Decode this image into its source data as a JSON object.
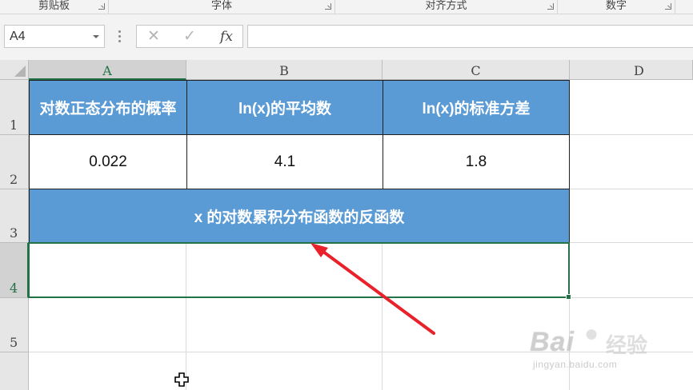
{
  "ribbon": {
    "groups": [
      {
        "label": "剪贴板"
      },
      {
        "label": "字体"
      },
      {
        "label": "对齐方式"
      },
      {
        "label": "数字"
      }
    ]
  },
  "formula_bar": {
    "name_box": "A4",
    "cancel_icon": "✕",
    "enter_icon": "✓",
    "fx_label": "fx",
    "formula": ""
  },
  "columns": [
    "A",
    "B",
    "C",
    "D"
  ],
  "rows": [
    "1",
    "2",
    "3",
    "4",
    "5"
  ],
  "cells": {
    "A1": "对数正态分布的概率",
    "B1": "ln(x)的平均数",
    "C1": "ln(x)的标准方差",
    "A2": "0.022",
    "B2": "4.1",
    "C2": "1.8",
    "A3": "x 的对数累积分布函数的反函数",
    "A4": ""
  },
  "colors": {
    "header_fill": "#5b9bd5",
    "selection": "#217346",
    "arrow": "#e8212a"
  },
  "watermark": {
    "brand": "Bai",
    "brand_suffix": "经验",
    "url": "jingyan.baidu.com"
  }
}
